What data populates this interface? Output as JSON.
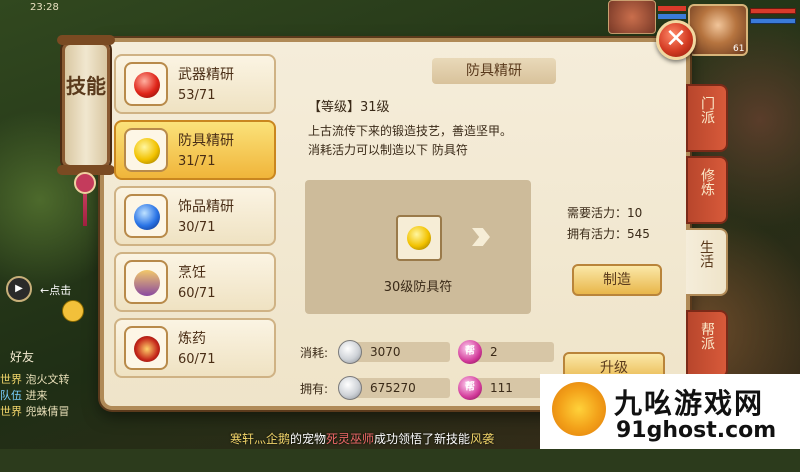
{
  "status_bar": {
    "time": "23:28"
  },
  "player": {
    "level": "61"
  },
  "scroll_tab": {
    "label": "技能"
  },
  "close_label": "✕",
  "skills": [
    {
      "name": "武器精研",
      "level": "53/71",
      "orb": "orb-red"
    },
    {
      "name": "防具精研",
      "level": "31/71",
      "orb": "orb-gold"
    },
    {
      "name": "饰品精研",
      "level": "30/71",
      "orb": "orb-blue"
    },
    {
      "name": "烹饪",
      "level": "60/71",
      "orb": "orb-pot"
    },
    {
      "name": "炼药",
      "level": "60/71",
      "orb": "orb-furnace"
    }
  ],
  "detail": {
    "title": "防具精研",
    "level_line": "【等级】31级",
    "desc_line1": "上古流传下来的锻造技艺，善造坚甲。",
    "desc_line2": "消耗活力可以制造以下 防具符",
    "item_name": "30级防具符",
    "need_vitality": "需要活力：10",
    "have_vitality": "拥有活力：545",
    "make_button": "制造",
    "cost_label": "消耗:",
    "own_label": "拥有:",
    "cost_silver": "3070",
    "cost_bang": "2",
    "own_silver": "675270",
    "own_bang": "111",
    "bang_icon_text": "帮",
    "upgrade_button": "升级"
  },
  "side_tabs": [
    {
      "label": "门派",
      "active": false
    },
    {
      "label": "修炼",
      "active": false
    },
    {
      "label": "生活",
      "active": true
    },
    {
      "label": "帮派",
      "active": false
    }
  ],
  "chat": {
    "hint": "←点击",
    "friends": "好友",
    "lines": [
      {
        "channel": "世界",
        "text": "泡火文转"
      },
      {
        "channel": "队伍",
        "text": "进来"
      },
      {
        "channel": "世界",
        "text": "兜蛛倩冒"
      }
    ]
  },
  "system_message": {
    "u1": "寒轩灬企鹅",
    "mid1": "的宠物",
    "u2": "死灵巫师",
    "mid2": "成功领悟了新技能",
    "u3": "风袭"
  },
  "watermark": {
    "name": "九吆游戏网",
    "url": "91ghost.com"
  },
  "colors": {
    "panel_bg": "#f5edda",
    "panel_border": "#b08a57",
    "selected_item": "#f0b53a",
    "tab_red": "#d85a3a",
    "close_red": "#d33a22"
  },
  "icons": [
    "close-icon",
    "silver-coin-icon",
    "guild-contribution-icon",
    "arrow-icon",
    "play-icon"
  ]
}
